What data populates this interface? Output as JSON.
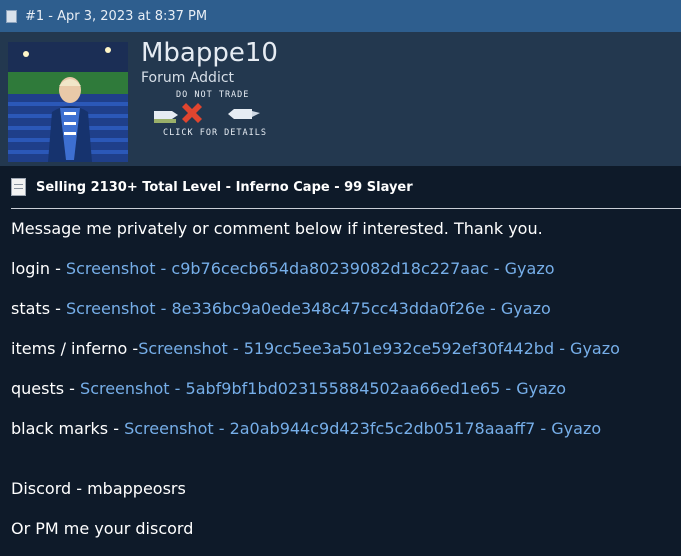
{
  "post_header": {
    "text": "#1 - Apr 3, 2023 at 8:37 PM"
  },
  "profile": {
    "username": "Mbappe10",
    "user_title": "Forum Addict",
    "badge": {
      "top_text": "DO NOT TRADE",
      "bottom_text": "CLICK FOR DETAILS"
    }
  },
  "post": {
    "title": "Selling 2130+ Total Level - Inferno Cape - 99 Slayer",
    "intro": "Message me privately or comment below if interested. Thank you.",
    "lines": [
      {
        "label": "login - ",
        "link": "Screenshot - c9b76cecb654da80239082d18c227aac - Gyazo"
      },
      {
        "label": "stats - ",
        "link": "Screenshot - 8e336bc9a0ede348c475cc43dda0f26e - Gyazo"
      },
      {
        "label": "items / inferno -",
        "link": "Screenshot - 519cc5ee3a501e932ce592ef30f442bd - Gyazo"
      },
      {
        "label": "quests - ",
        "link": "Screenshot - 5abf9bf1bd023155884502aa66ed1e65 - Gyazo"
      },
      {
        "label": "black marks - ",
        "link": "Screenshot - 2a0ab944c9d423fc5c2db05178aaaff7 - Gyazo"
      }
    ],
    "discord": "Discord - mbappeosrs",
    "pm": "Or PM me your discord"
  },
  "colors": {
    "background": "#0e1a29",
    "header_bar": "#2e5e8e",
    "profile_bg": "#23384f",
    "link": "#76aee8",
    "badge_x": "#e0452f"
  }
}
